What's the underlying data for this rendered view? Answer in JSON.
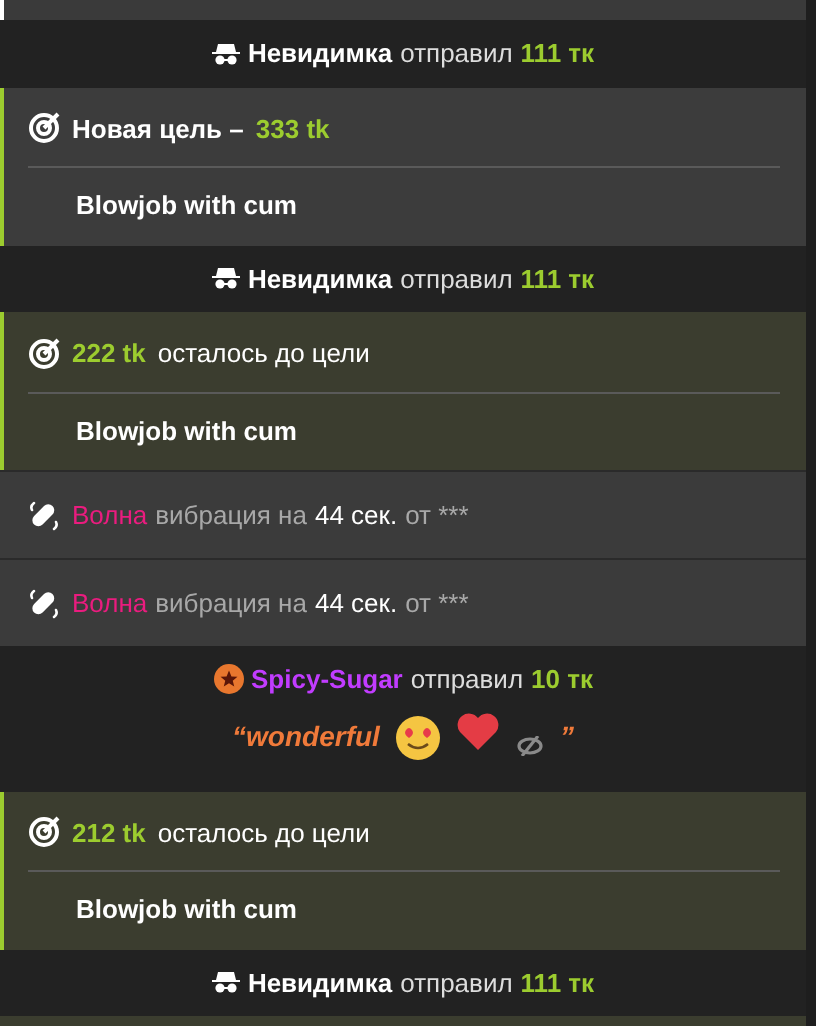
{
  "feed": [
    {
      "kind": "anonymous_tip",
      "sender": "Невидимка",
      "color": "#ffffff",
      "verb": "отправил",
      "amount": "111 тк"
    },
    {
      "kind": "new_goal",
      "title": "Новая цель –",
      "amount": "333 tk",
      "goal": "Blowjob with cum"
    },
    {
      "kind": "anonymous_tip",
      "sender": "Невидимка",
      "color": "#ffffff",
      "verb": "отправил",
      "amount": "111 тк"
    },
    {
      "kind": "goal_progress",
      "amount": "222 tk",
      "text": "осталось до цели",
      "goal": "Blowjob with cum"
    },
    {
      "kind": "vibration",
      "pattern": "Волна",
      "text": "вибрация на",
      "duration": "44 сек.",
      "from": "от ***"
    },
    {
      "kind": "vibration",
      "pattern": "Волна",
      "text": "вибрация на",
      "duration": "44 сек.",
      "from": "от ***"
    },
    {
      "kind": "user_tip",
      "sender": "Spicy-Sugar",
      "color": "#c13cff",
      "verb": "отправил",
      "amount": "10 тк",
      "message_open": "“wonderful",
      "message_close": "”"
    },
    {
      "kind": "goal_progress",
      "amount": "212 tk",
      "text": "осталось до цели",
      "goal": "Blowjob with cum"
    },
    {
      "kind": "anonymous_tip",
      "sender": "Невидимка",
      "color": "#ffffff",
      "verb": "отправил",
      "amount": "111 тк"
    }
  ]
}
